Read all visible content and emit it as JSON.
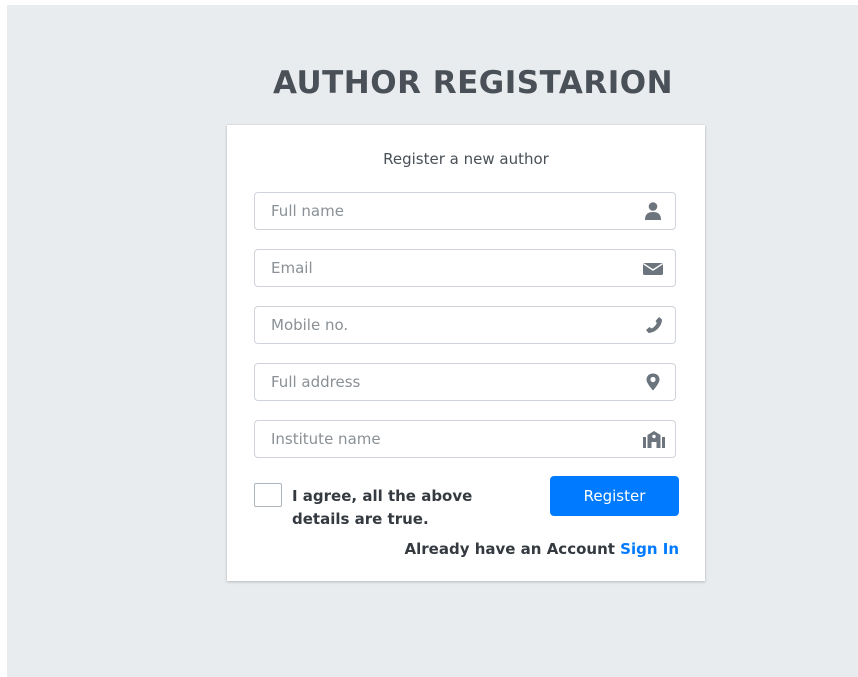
{
  "page": {
    "heading": "AUTHOR REGISTARION"
  },
  "form": {
    "subtitle": "Register a new author",
    "fields": [
      {
        "placeholder": "Full name",
        "icon": "user-icon"
      },
      {
        "placeholder": "Email",
        "icon": "envelope-icon"
      },
      {
        "placeholder": "Mobile no.",
        "icon": "phone-icon"
      },
      {
        "placeholder": "Full address",
        "icon": "map-marker-icon"
      },
      {
        "placeholder": "Institute name",
        "icon": "institution-icon"
      }
    ],
    "agree_label": "I agree, all the above details are true.",
    "agree_checked": false,
    "register_label": "Register",
    "account_text": "Already have an Account",
    "signin_label": "Sign In"
  },
  "colors": {
    "background": "#e9ecef",
    "card": "#ffffff",
    "primary": "#007bff",
    "heading": "#495057",
    "icon": "#6c757d"
  }
}
